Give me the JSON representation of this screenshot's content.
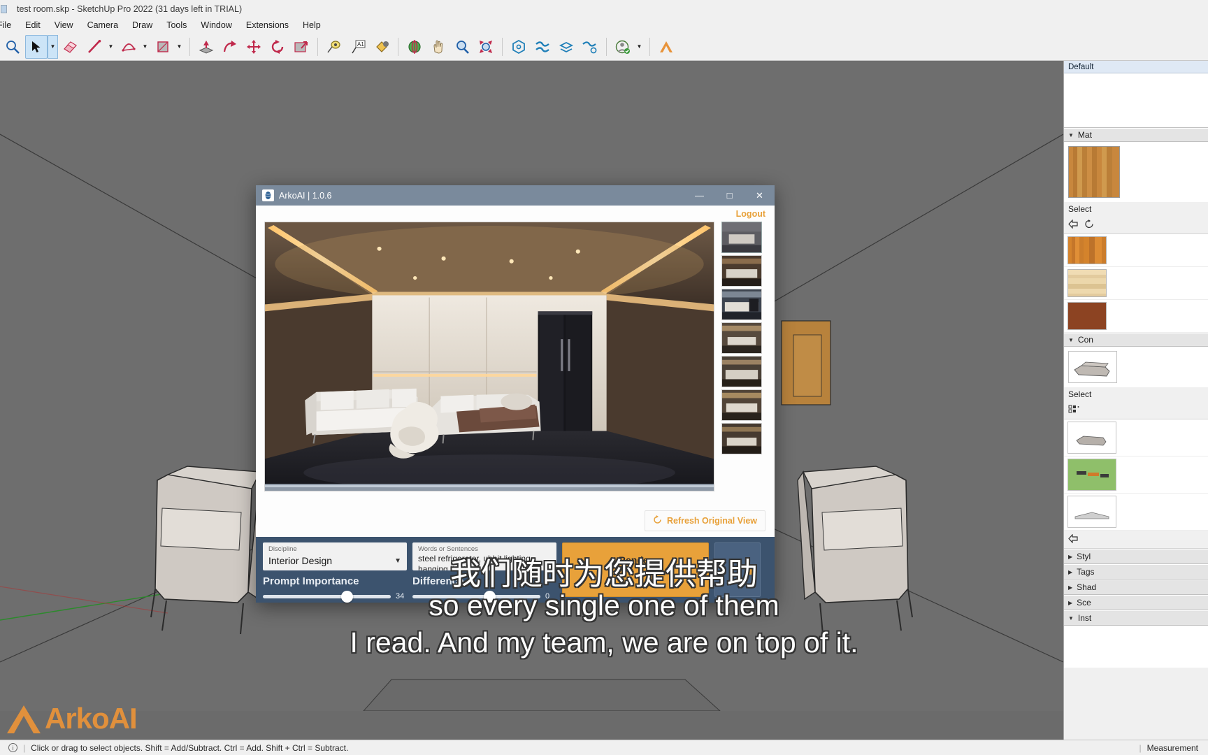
{
  "sketchup": {
    "window_title": "test room.skp - SketchUp Pro 2022 (31 days left in TRIAL)",
    "menus": [
      "File",
      "Edit",
      "View",
      "Camera",
      "Draw",
      "Tools",
      "Window",
      "Extensions",
      "Help"
    ],
    "toolbar_icons": [
      "zoom-icon",
      "select-arrow-icon",
      "select-dropdown-icon",
      "eraser-icon",
      "line-icon",
      "line-dropdown-icon",
      "arc-icon",
      "arc-dropdown-icon",
      "rectangle-icon",
      "rectangle-dropdown-icon",
      "pushpull-icon",
      "followme-icon",
      "move-icon",
      "rotate-icon",
      "offset-icon",
      "tape-measure-icon",
      "text-icon",
      "paint-bucket-icon",
      "orbit-icon",
      "pan-icon",
      "zoom-window-icon",
      "zoom-extents-icon",
      "solid-tools-icon",
      "sandbox-icon",
      "layers-icon",
      "sandbox-settings-icon",
      "account-icon",
      "account-dropdown-icon",
      "arko-extension-icon"
    ],
    "status_text": "Click or drag to select objects. Shift = Add/Subtract. Ctrl = Add. Shift + Ctrl = Subtract.",
    "measurements_label": "Measurement",
    "watermark": "ArkoAI"
  },
  "right_panel": {
    "tab_label": "Default",
    "sections": [
      {
        "title": "Mat",
        "select_label": "Select"
      },
      {
        "title": "Con",
        "select_label": "Select"
      }
    ],
    "collapsed": [
      "Styl",
      "Tags",
      "Shad",
      "Sce",
      "Inst"
    ],
    "material_swatches": [
      "#c8873d",
      "#d4832c",
      "#e8d3a8",
      "#8c4322"
    ],
    "component_thumbs": [
      "sofa-thumbnail",
      "sofa-small-thumbnail",
      "site-plan-thumbnail",
      "bench-thumbnail"
    ]
  },
  "arko_dialog": {
    "title": "ArkoAI | 1.0.6",
    "window_buttons": {
      "minimize": "—",
      "maximize": "□",
      "close": "✕"
    },
    "logout_label": "Logout",
    "refresh_label": "Refresh Original View",
    "refresh_icon": "refresh-icon",
    "thumbnail_count": 7,
    "controls": {
      "discipline": {
        "label": "Discipline",
        "value": "Interior Design"
      },
      "prompt": {
        "label": "Words or Sentences",
        "value": "steel refrigerator, uhhit lighting, hanging lighting"
      },
      "prompt_importance": {
        "label": "Prompt Importance",
        "value": 34,
        "min": 0,
        "max": 100
      },
      "difference": {
        "label": "Difference",
        "value": 0
      },
      "render_button": "Render"
    },
    "accent_color": "#e8a13a",
    "footer_color": "#3c536e"
  },
  "subtitles": {
    "line_cn": "我们随时为您提供帮助",
    "line_1": "so every single one of them",
    "line_2": "I read. And my team, we are on top of it."
  }
}
